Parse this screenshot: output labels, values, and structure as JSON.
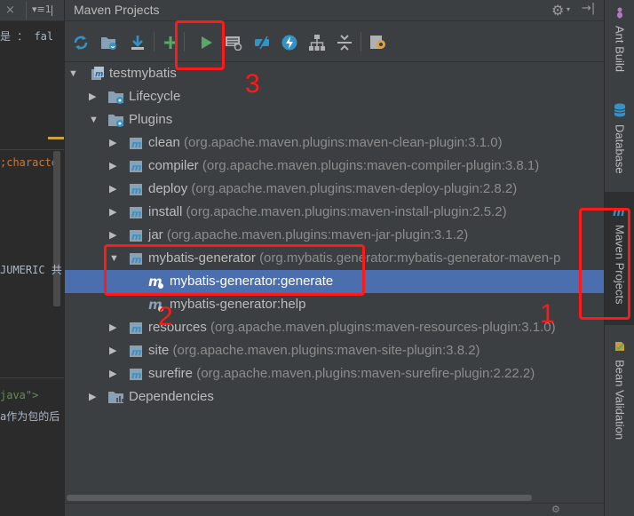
{
  "editor": {
    "tab_close": "×",
    "tab_menu": "▾≡1",
    "lines": [
      {
        "text": "是 ： fal",
        "color": "#a9b7c6"
      },
      {
        "text": ";characte",
        "color": "#cc7832"
      },
      {
        "text": "JUMERIC 共",
        "color": "#a9b7c6"
      },
      {
        "text": "java\">",
        "color": "#6a8759"
      },
      {
        "text": "a作为包的后",
        "color": "#a9b7c6"
      }
    ]
  },
  "panel": {
    "title": "Maven Projects",
    "gear": "⚙",
    "gear_caret": "▾",
    "hide": "→|"
  },
  "toolbar": {
    "buttons": [
      {
        "name": "reimport-all-icon"
      },
      {
        "name": "generate-sources-icon"
      },
      {
        "name": "download-sources-icon"
      },
      {
        "name": "add-maven-project-icon"
      },
      {
        "name": "run-maven-build-icon"
      },
      {
        "name": "execute-maven-goal-icon"
      },
      {
        "name": "toggle-offline-mode-icon"
      },
      {
        "name": "toggle-skip-tests-icon"
      },
      {
        "name": "show-dependencies-icon"
      },
      {
        "name": "collapse-all-icon"
      },
      {
        "name": "maven-settings-icon"
      }
    ],
    "colors": {
      "accent_green": "#59a869",
      "accent_blue": "#3592c4"
    }
  },
  "tree": {
    "rows": [
      {
        "label": "testmybatis",
        "coord": "",
        "arrow": "▼",
        "icon": "maven-module-icon"
      },
      {
        "label": "Lifecycle",
        "coord": "",
        "arrow": "▶",
        "icon": "lifecycle-folder-icon"
      },
      {
        "label": "Plugins",
        "coord": "",
        "arrow": "▼",
        "icon": "plugins-folder-icon"
      },
      {
        "label": "clean",
        "coord": "(org.apache.maven.plugins:maven-clean-plugin:3.1.0)",
        "arrow": "▶",
        "icon": "plugin-icon"
      },
      {
        "label": "compiler",
        "coord": "(org.apache.maven.plugins:maven-compiler-plugin:3.8.1)",
        "arrow": "▶",
        "icon": "plugin-icon"
      },
      {
        "label": "deploy",
        "coord": "(org.apache.maven.plugins:maven-deploy-plugin:2.8.2)",
        "arrow": "▶",
        "icon": "plugin-icon"
      },
      {
        "label": "install",
        "coord": "(org.apache.maven.plugins:maven-install-plugin:2.5.2)",
        "arrow": "▶",
        "icon": "plugin-icon"
      },
      {
        "label": "jar",
        "coord": "(org.apache.maven.plugins:maven-jar-plugin:3.1.2)",
        "arrow": "▶",
        "icon": "plugin-icon"
      },
      {
        "label": "mybatis-generator",
        "coord": "(org.mybatis.generator:mybatis-generator-maven-p",
        "arrow": "▼",
        "icon": "plugin-icon"
      },
      {
        "label": "mybatis-generator:generate",
        "coord": "",
        "arrow": "",
        "icon": "goal-icon",
        "selected": true
      },
      {
        "label": "mybatis-generator:help",
        "coord": "",
        "arrow": "",
        "icon": "goal-icon"
      },
      {
        "label": "resources",
        "coord": "(org.apache.maven.plugins:maven-resources-plugin:3.1.0)",
        "arrow": "▶",
        "icon": "plugin-icon"
      },
      {
        "label": "site",
        "coord": "(org.apache.maven.plugins:maven-site-plugin:3.8.2)",
        "arrow": "▶",
        "icon": "plugin-icon"
      },
      {
        "label": "surefire",
        "coord": "(org.apache.maven.plugins:maven-surefire-plugin:2.22.2)",
        "arrow": "▶",
        "icon": "plugin-icon"
      },
      {
        "label": "Dependencies",
        "coord": "",
        "arrow": "▶",
        "icon": "dependencies-folder-icon"
      }
    ],
    "selected_color": "#4b6eaf"
  },
  "right_strip": {
    "tabs": [
      {
        "label": "Ant Build",
        "icon": "ant-icon"
      },
      {
        "label": "Database",
        "icon": "database-icon"
      },
      {
        "label": "Maven Projects",
        "icon": "maven-icon",
        "active": true
      },
      {
        "label": "Bean Validation",
        "icon": "bean-validation-icon"
      }
    ]
  },
  "annotations": {
    "color": "#ff1a1a",
    "labels": [
      "1",
      "2",
      "3"
    ]
  }
}
